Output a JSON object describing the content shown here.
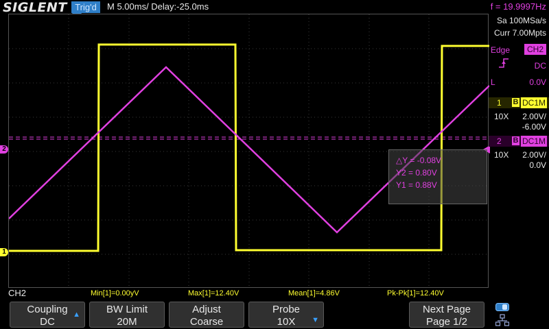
{
  "header": {
    "logo": "SIGLENT",
    "trigger_status": "Trig'd",
    "timebase": "M 5.00ms/ Delay:-25.0ms",
    "frequency": "f = 19.9997Hz"
  },
  "right_panel": {
    "sample_rate": "Sa 100MSa/s",
    "memory": "Curr 7.00Mpts",
    "trigger": {
      "type": "Edge",
      "source": "CH2",
      "coupling": "DC",
      "level_label": "L",
      "level": "0.0V"
    },
    "ch1": {
      "number": "1",
      "bw": "B",
      "coupling": "DC1M",
      "probe": "10X",
      "scale": "2.00V/",
      "offset": "-6.00V"
    },
    "ch2": {
      "number": "2",
      "bw": "B",
      "coupling": "DC1M",
      "probe": "10X",
      "scale": "2.00V/",
      "offset": "0.0V"
    }
  },
  "cursors": {
    "delta": "△Y = -0.08V",
    "y2": "Y2 = 0.80V",
    "y1": "Y1 = 0.88V"
  },
  "markers": {
    "ch1": "1",
    "ch2": "2"
  },
  "measurements": {
    "channel": "CH2",
    "min": "Min[1]=0.00yV",
    "max": "Max[1]=12.40V",
    "mean": "Mean[1]=4.86V",
    "pkpk": "Pk-Pk[1]=12.40V"
  },
  "softkeys": [
    {
      "line1": "Coupling",
      "line2": "DC"
    },
    {
      "line1": "BW Limit",
      "line2": "20M"
    },
    {
      "line1": "Adjust",
      "line2": "Coarse"
    },
    {
      "line1": "Probe",
      "line2": "10X"
    },
    {
      "line1": "Next Page",
      "line2": "Page 1/2"
    }
  ],
  "colors": {
    "ch1": "#ffff30",
    "ch2": "#e040e0",
    "accent": "#2f7fc8",
    "softkey_bg": "#303030"
  }
}
